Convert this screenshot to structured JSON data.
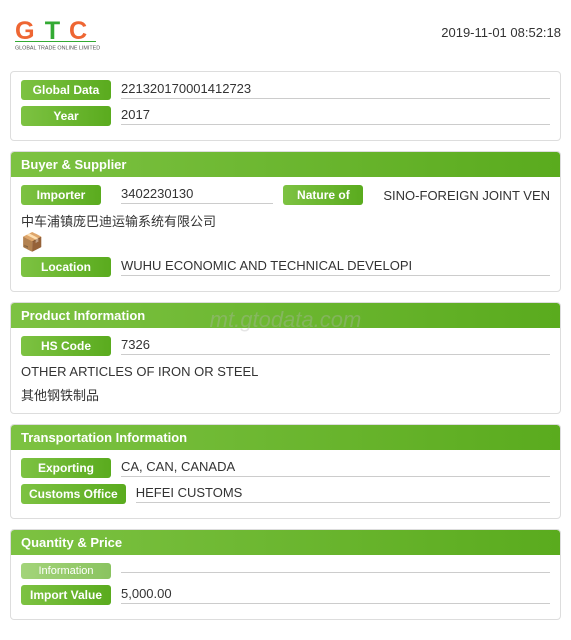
{
  "header": {
    "timestamp": "2019-11-01 08:52:18",
    "logo_alt": "Global Trade Online Limited"
  },
  "watermark": "mt.gtodata.com",
  "sections": {
    "global_data": {
      "header": "Global Data",
      "fields": [
        {
          "label": "Global Data",
          "value": "221320170001412723"
        },
        {
          "label": "Year",
          "value": "2017"
        }
      ]
    },
    "buyer_supplier": {
      "header": "Buyer & Supplier",
      "importer_label": "Importer",
      "importer_value": "3402230130",
      "nature_label": "Nature of",
      "nature_value": "SINO-FOREIGN JOINT VEN",
      "company_name": "中车浦镇庞巴迪运输系统有限公司",
      "company_icon": "📦",
      "location_label": "Location",
      "location_value": "WUHU ECONOMIC AND TECHNICAL DEVELOPI"
    },
    "product_info": {
      "header": "Product Information",
      "hs_label": "HS Code",
      "hs_value": "7326",
      "desc_en": "OTHER ARTICLES OF IRON OR STEEL",
      "desc_cn": "其他钢铁制品"
    },
    "transportation": {
      "header": "Transportation Information",
      "exporting_label": "Exporting",
      "exporting_value": "CA, CAN, CANADA",
      "customs_label": "Customs Office",
      "customs_value": "HEFEI CUSTOMS"
    },
    "quantity_price": {
      "header": "Quantity & Price",
      "import_label": "Import Value",
      "import_value": "5,000.00",
      "hidden_label": "Information"
    }
  }
}
